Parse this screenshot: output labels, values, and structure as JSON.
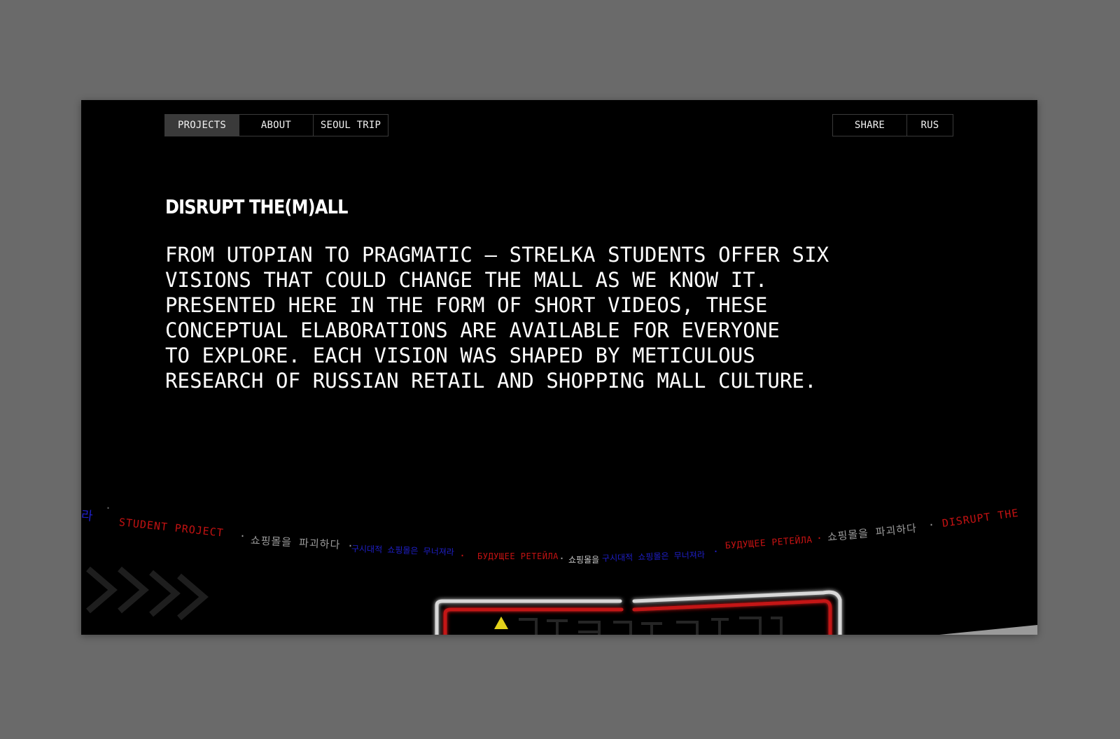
{
  "nav": {
    "left": [
      {
        "label": "PROJECTS",
        "active": true
      },
      {
        "label": "ABOUT",
        "active": false
      },
      {
        "label": "SEOUL TRIP",
        "active": false
      }
    ],
    "right": [
      {
        "label": "SHARE"
      },
      {
        "label": "RUS"
      }
    ]
  },
  "hero": {
    "title": "DISRUPT THE(M)ALL",
    "description": "FROM UTOPIAN TO PRAGMATIC — STRELKA STUDENTS OFFER SIX\nVISIONS THAT COULD CHANGE THE MALL AS WE KNOW IT.\nPRESENTED HERE IN THE FORM OF SHORT VIDEOS, THESE\nCONCEPTUAL ELABORATIONS ARE AVAILABLE FOR EVERYONE\nTO EXPLORE. EACH VISION WAS SHAPED BY METICULOUS\nRESEARCH OF RUSSIAN RETAIL AND SHOPPING MALL CULTURE."
  },
  "ticker": {
    "left_fragment": "라",
    "student_project": "STUDENT PROJECT",
    "korean_disrupt": "쇼핑몰을 파괴하다",
    "korean_future": "구시대적 쇼핑몰은 무너져라",
    "russian_future": "БУДУЩЕЕ РЕТЕЙЛА",
    "korean_short": "쇼핑몰을",
    "disrupt": "DISRUPT THE",
    "separator": "·"
  },
  "colors": {
    "background": "#000000",
    "frame_outer": "#6a6a6a",
    "nav_active": "#3a3a3a",
    "ticker_red": "#c21212",
    "ticker_blue": "#1f1fc8",
    "ticker_grey": "#9a9a9a"
  },
  "icons": {
    "chevrons": "chevron-right-icon",
    "warning": "warning-triangle-icon"
  }
}
